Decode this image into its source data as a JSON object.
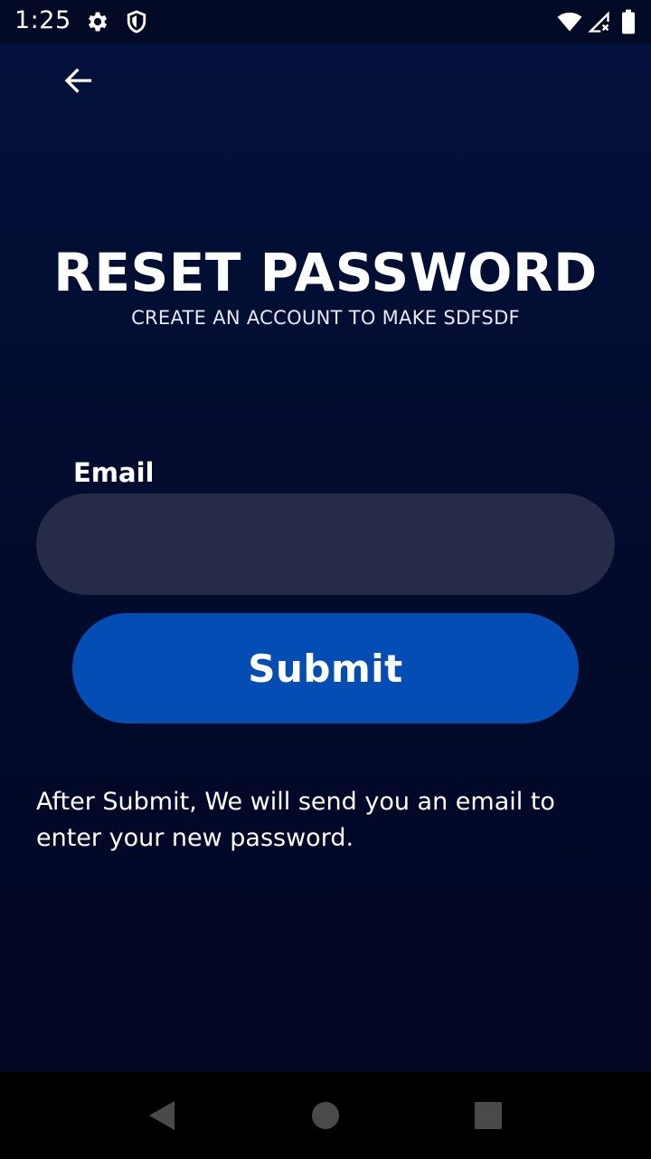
{
  "status_bar": {
    "time": "1:25",
    "icons": [
      "gear-icon",
      "shield-icon",
      "wifi-icon",
      "cellular-signal-icon",
      "battery-icon"
    ]
  },
  "header": {
    "back_icon": "arrow-left-icon"
  },
  "main": {
    "title": "RESET PASSWORD",
    "subtitle": "CREATE AN ACCOUNT TO MAKE SDFSDF",
    "email_label": "Email",
    "email_value": "",
    "email_placeholder": "",
    "submit_label": "Submit",
    "info_text": "After Submit, We will send you an email to enter your new password."
  },
  "nav_bar": {
    "icons": [
      "back-triangle-icon",
      "home-circle-icon",
      "recents-square-icon"
    ]
  },
  "colors": {
    "background": "#03113d",
    "input_background": "#262b48",
    "button_background": "#034db4",
    "text": "#ffffff"
  }
}
